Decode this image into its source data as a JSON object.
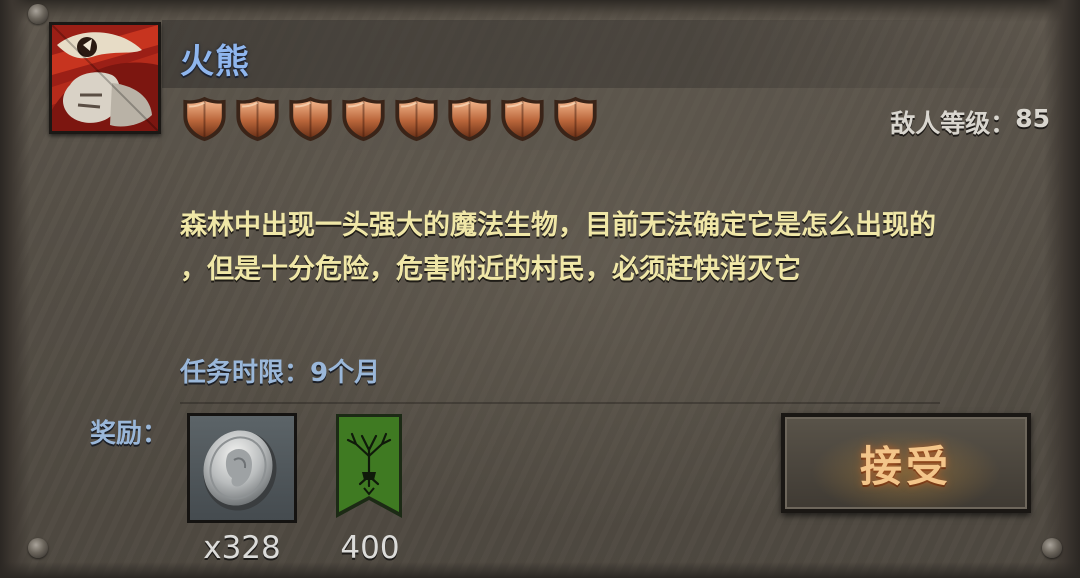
{
  "enemy": {
    "name": "火熊",
    "portrait_icon": "red-bear-portrait-icon",
    "difficulty_shields": 8,
    "shield_icon": "bronze-shield-icon",
    "level_label": "敌人等级：",
    "level_value": "85"
  },
  "quest": {
    "description_line1": "森林中出现一头强大的魔法生物，目前无法确定它是怎么出现的",
    "description_line2": "，但是十分危险，危害附近的村民，必须赶快消灭它",
    "time_limit_label": "任务时限：",
    "time_limit_value": "9个月"
  },
  "rewards": {
    "label": "奖励：",
    "items": [
      {
        "icon": "silver-coin-icon",
        "count": "x328"
      },
      {
        "icon": "tree-banner-icon",
        "count": "400"
      }
    ]
  },
  "actions": {
    "accept_label": "接受"
  },
  "colors": {
    "name": "#8fb6ee",
    "description": "#f0e7a7",
    "labels": "#9ab7d9",
    "accept_text": "#f3c58a",
    "banner_green": "#3f7a22"
  }
}
